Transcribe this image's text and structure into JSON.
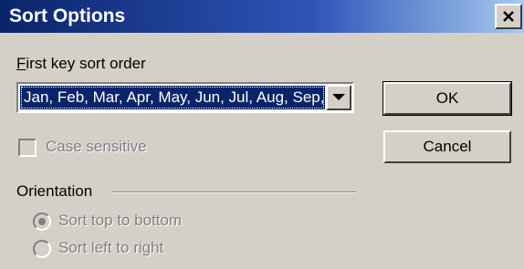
{
  "window": {
    "title": "Sort Options",
    "close_icon": "close-icon"
  },
  "sort_key": {
    "label_first_char": "F",
    "label_rest": "irst key sort order",
    "selected_value": "Jan, Feb, Mar, Apr, May, Jun, Jul, Aug, Sep, Oct, Nov, Dec",
    "dropdown_icon": "chevron-down-icon"
  },
  "buttons": {
    "ok_label": "OK",
    "cancel_label": "Cancel"
  },
  "case_sensitive": {
    "label": "Case sensitive",
    "checked": false,
    "enabled": false
  },
  "orientation": {
    "label": "Orientation",
    "options": [
      {
        "label": "Sort top to bottom",
        "selected": true,
        "enabled": false
      },
      {
        "label": "Sort left to right",
        "selected": false,
        "enabled": false
      }
    ]
  },
  "colors": {
    "titlebar": "#0a246a",
    "face": "#d4d0c8",
    "selection": "#0a246a",
    "disabled_text": "#808080"
  }
}
